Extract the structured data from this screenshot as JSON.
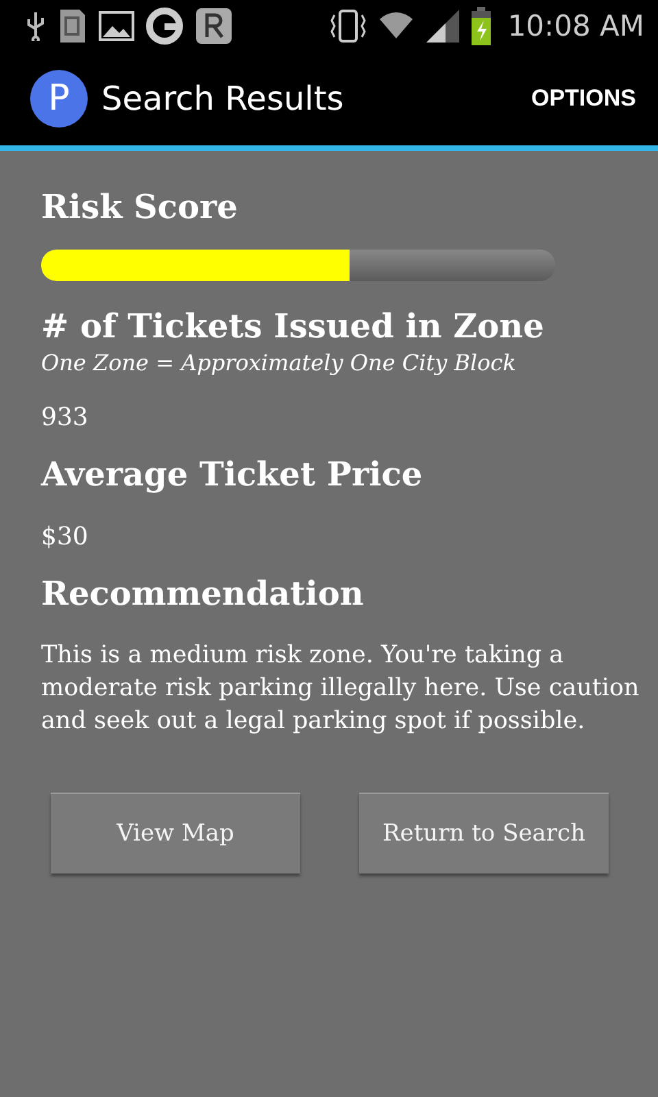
{
  "status_bar": {
    "time": "10:08 AM"
  },
  "action_bar": {
    "app_letter": "P",
    "title": "Search Results",
    "menu": "OPTIONS"
  },
  "risk": {
    "heading": "Risk Score",
    "level": 0.6
  },
  "tickets": {
    "heading": "# of Tickets Issued in Zone",
    "note": "One Zone = Approximately One City Block",
    "value": "933"
  },
  "price": {
    "heading": "Average Ticket Price",
    "value": "$30"
  },
  "recommendation": {
    "heading": "Recommendation",
    "text": "This is a medium risk zone. You're taking a moderate risk parking illegally here. Use caution and seek out a legal parking spot if possible."
  },
  "buttons": [
    "View Map",
    "Return to Search"
  ]
}
